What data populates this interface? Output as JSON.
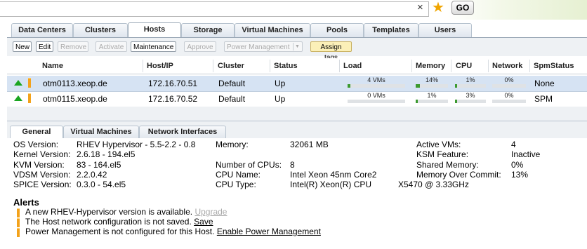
{
  "top": {
    "go_label": "GO",
    "clear_glyph": "×",
    "star_glyph": "★"
  },
  "main_tabs": [
    "Data Centers",
    "Clusters",
    "Hosts",
    "Storage",
    "Virtual Machines",
    "Pools",
    "Templates",
    "Users"
  ],
  "toolbar": {
    "new": "New",
    "edit": "Edit",
    "remove": "Remove",
    "activate": "Activate",
    "maintenance": "Maintenance",
    "approve": "Approve",
    "power_management": "Power Management",
    "assign_tags": "Assign tags"
  },
  "grid": {
    "columns": [
      "Name",
      "Host/IP",
      "Cluster",
      "Status",
      "Load",
      "Memory",
      "CPU",
      "Network",
      "SpmStatus"
    ],
    "rows": [
      {
        "name": "otm0113.xeop.de",
        "ip": "172.16.70.51",
        "cluster": "Default",
        "status": "Up",
        "load": "4 VMs",
        "memory": "14%",
        "cpu": "1%",
        "network": "0%",
        "spm": "None"
      },
      {
        "name": "otm0115.xeop.de",
        "ip": "172.16.70.52",
        "cluster": "Default",
        "status": "Up",
        "load": "0 VMs",
        "memory": "1%",
        "cpu": "3%",
        "network": "0%",
        "spm": "SPM"
      }
    ]
  },
  "sub_tabs": [
    "General",
    "Virtual Machines",
    "Network Interfaces"
  ],
  "general": {
    "os_version_label": "OS Version:",
    "os_version": "RHEV Hypervisor - 5.5-2.2 - 0.8",
    "kernel_label": "Kernel Version:",
    "kernel": "2.6.18 - 194.el5",
    "kvm_label": "KVM Version:",
    "kvm": "83 - 164.el5",
    "vdsm_label": "VDSM Version:",
    "vdsm": "2.2.0.42",
    "spice_label": "SPICE Version:",
    "spice": "0.3.0 - 54.el5",
    "memory_label": "Memory:",
    "memory": "32061 MB",
    "cpus_label": "Number of CPUs:",
    "cpus": "8",
    "cpu_name_label": "CPU Name:",
    "cpu_name": "Intel Xeon 45nm Core2",
    "cpu_type_label": "CPU Type:",
    "cpu_type": "Intel(R) Xeon(R) CPU",
    "cpu_type_extra": "X5470  @ 3.33GHz",
    "active_vms_label": "Active VMs:",
    "active_vms": "4",
    "ksm_label": "KSM Feature:",
    "ksm": "Inactive",
    "shared_mem_label": "Shared Memory:",
    "shared_mem": "0%",
    "overcommit_label": "Memory Over Commit:",
    "overcommit": "13%"
  },
  "alerts": {
    "title": "Alerts",
    "items": [
      {
        "text": "A new RHEV-Hypervisor version is available.",
        "link": "Upgrade"
      },
      {
        "text": "The Host network configuration is not saved.",
        "link": "Save"
      },
      {
        "text": "Power Management is not configured for this Host.",
        "link": "Enable Power Management"
      }
    ]
  },
  "colors": {
    "selected_row": "#d6e3f3",
    "status_up": "#1aa521",
    "warning": "#f3a21b",
    "bar_fill": "#3c9a2f"
  },
  "icons": [
    "up-arrow-icon",
    "warning-icon",
    "star-icon",
    "clear-icon"
  ],
  "usage_fill_fraction": {
    "row1": {
      "memory": 0.14,
      "cpu": 0.01,
      "network": 0.0,
      "load": 0.05
    },
    "row2": {
      "memory": 0.01,
      "cpu": 0.03,
      "network": 0.0,
      "load": 0.0
    }
  }
}
